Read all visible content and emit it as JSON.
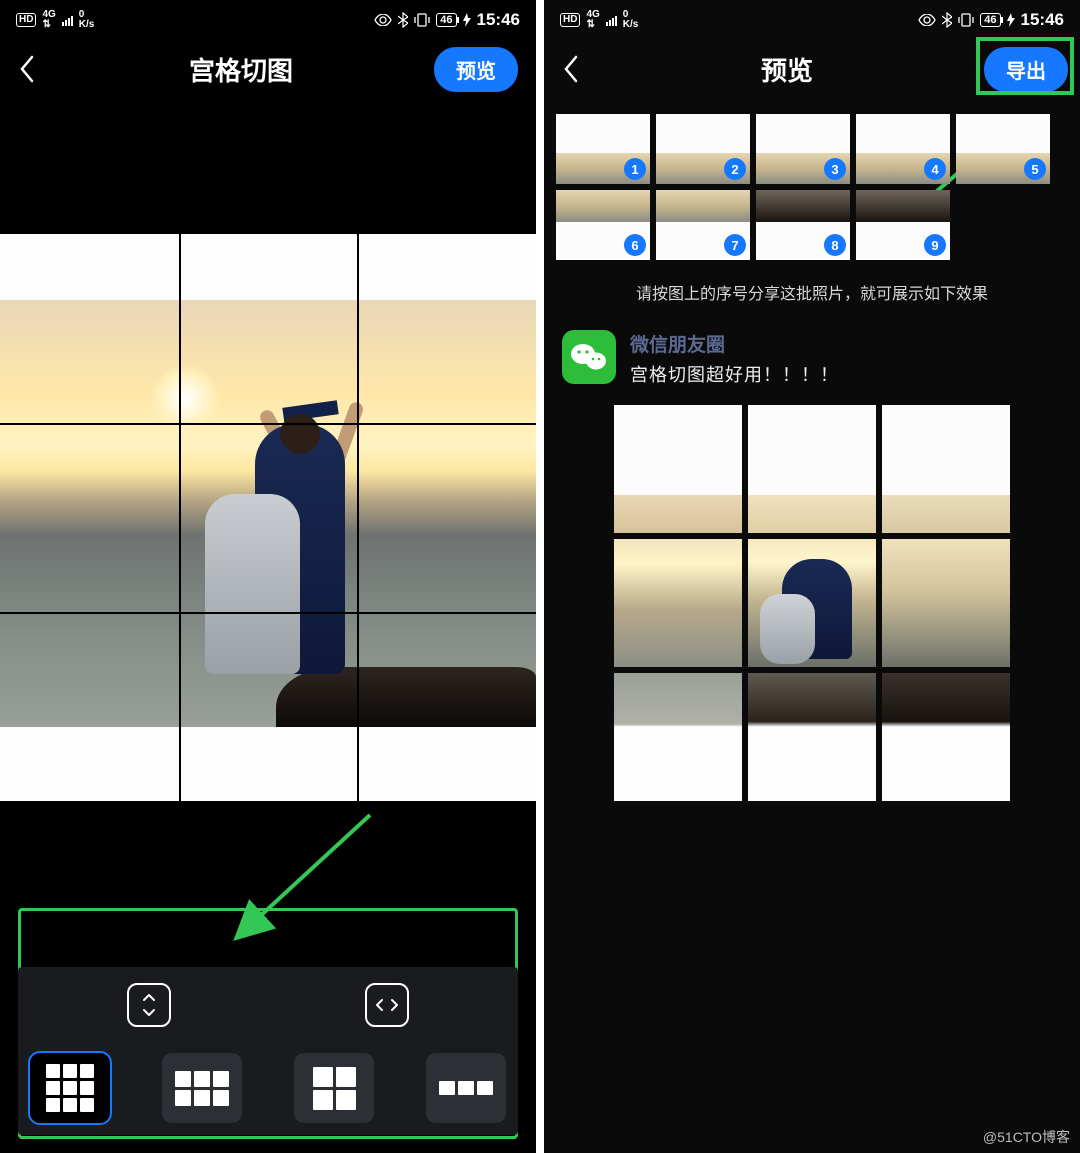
{
  "status": {
    "hd": "HD",
    "net": "4G",
    "speed_val": "0",
    "speed_unit": "K/s",
    "battery": "46",
    "time": "15:46"
  },
  "left": {
    "title": "宫格切图",
    "preview_btn": "预览"
  },
  "right": {
    "title": "预览",
    "export_btn": "导出",
    "hint": "请按图上的序号分享这批照片，就可展示如下效果",
    "post_name": "微信朋友圈",
    "post_body": "宫格切图超好用！！！！",
    "thumb_nums": [
      "1",
      "2",
      "3",
      "4",
      "5",
      "6",
      "7",
      "8",
      "9"
    ]
  },
  "colors": {
    "accent": "#1677ff",
    "highlight": "#33c755",
    "wechat": "#2dbd3a"
  },
  "watermark": "@51CTO博客"
}
